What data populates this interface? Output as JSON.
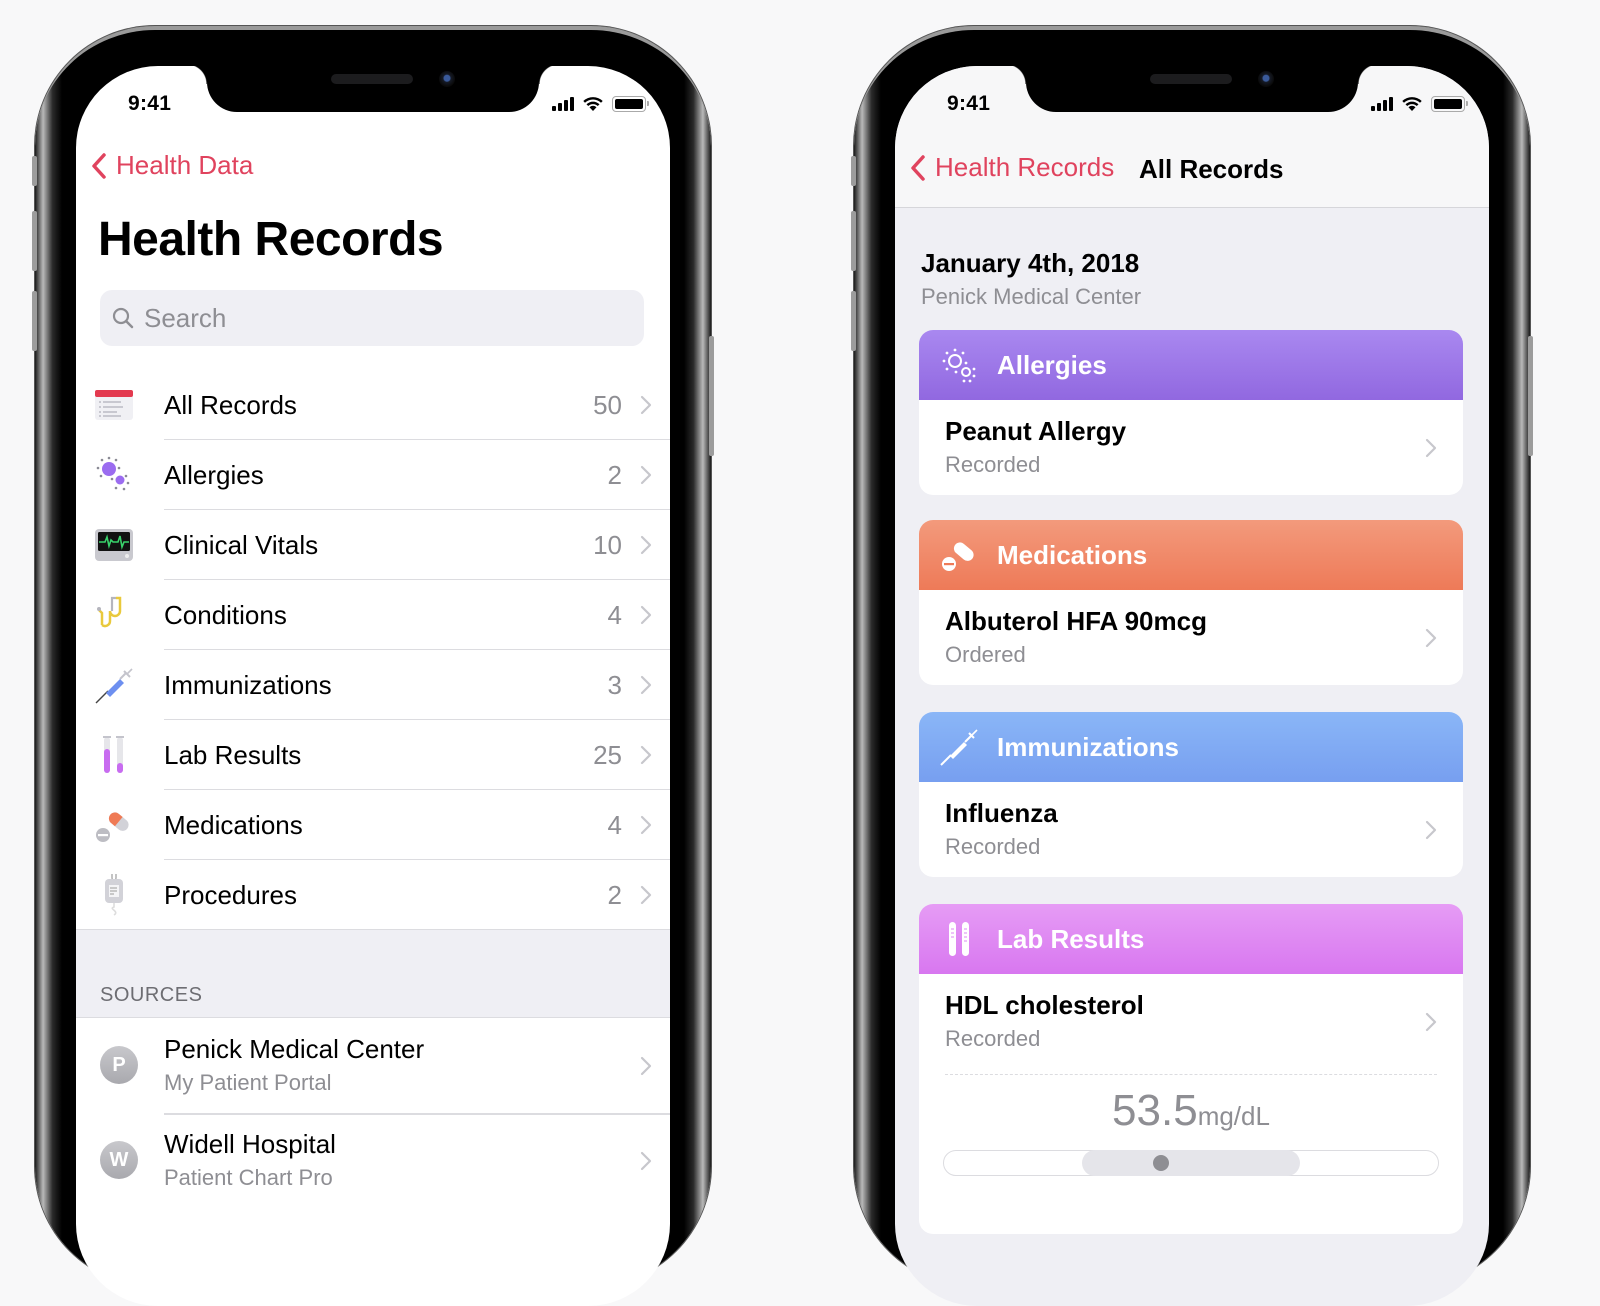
{
  "status_bar": {
    "time": "9:41"
  },
  "left_screen": {
    "back_label": "Health Data",
    "title": "Health Records",
    "search": {
      "placeholder": "Search",
      "value": ""
    },
    "categories": [
      {
        "label": "All Records",
        "count": "50",
        "icon": "all-records-icon"
      },
      {
        "label": "Allergies",
        "count": "2",
        "icon": "allergies-icon"
      },
      {
        "label": "Clinical Vitals",
        "count": "10",
        "icon": "clinical-vitals-icon"
      },
      {
        "label": "Conditions",
        "count": "4",
        "icon": "stethoscope-icon"
      },
      {
        "label": "Immunizations",
        "count": "3",
        "icon": "syringe-icon"
      },
      {
        "label": "Lab Results",
        "count": "25",
        "icon": "test-tubes-icon"
      },
      {
        "label": "Medications",
        "count": "4",
        "icon": "pills-icon"
      },
      {
        "label": "Procedures",
        "count": "2",
        "icon": "iv-bag-icon"
      }
    ],
    "sources_header": "SOURCES",
    "sources": [
      {
        "initial": "P",
        "name": "Penick Medical Center",
        "subtitle": "My Patient Portal"
      },
      {
        "initial": "W",
        "name": "Widell Hospital",
        "subtitle": "Patient Chart Pro"
      }
    ]
  },
  "right_screen": {
    "back_label": "Health Records",
    "title": "All Records",
    "date": "January 4th, 2018",
    "provider": "Penick Medical Center",
    "cards": [
      {
        "category": "Allergies",
        "item": "Peanut Allergy",
        "status": "Recorded",
        "color": "#9b74e8"
      },
      {
        "category": "Medications",
        "item": "Albuterol HFA 90mcg",
        "status": "Ordered",
        "color": "#f08663"
      },
      {
        "category": "Immunizations",
        "item": "Influenza",
        "status": "Recorded",
        "color": "#80a9f3"
      },
      {
        "category": "Lab Results",
        "item": "HDL cholesterol",
        "status": "Recorded",
        "color": "#de88f3",
        "value": "53.5",
        "unit": "mg/dL",
        "range": {
          "normal_start_fraction": 0.28,
          "normal_end_fraction": 0.72,
          "value_fraction": 0.44
        }
      }
    ]
  },
  "colors": {
    "accent": "#e0435e",
    "secondary_text": "#8e8e93",
    "grouped_background": "#efeff4"
  }
}
